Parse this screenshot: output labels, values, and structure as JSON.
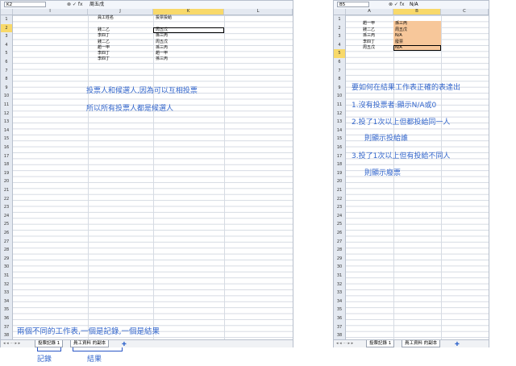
{
  "left": {
    "name_box": "K2",
    "fx_symbols": "⊗ ✓ fx",
    "formula_value": "周五戊",
    "columns": [
      "I",
      "J",
      "K",
      "L"
    ],
    "rows": [
      "1",
      "2",
      "3",
      "4",
      "5",
      "6",
      "7",
      "8",
      "9",
      "10",
      "11",
      "12",
      "13",
      "14",
      "15",
      "16",
      "17",
      "18",
      "19",
      "20",
      "21",
      "22",
      "23",
      "24",
      "25",
      "26",
      "27",
      "28",
      "29",
      "30",
      "31",
      "32",
      "33",
      "34",
      "35",
      "36",
      "37",
      "38"
    ],
    "header_voter": "員工姓名",
    "header_vote": "投票投給",
    "voters": [
      "錢二乙",
      "李四丁",
      "錢二乙",
      "趙一甲",
      "李四丁",
      "李四丁"
    ],
    "votes": [
      "周五戊",
      "孫三丙",
      "周五戊",
      "孫三丙",
      "趙一甲",
      "孫三丙"
    ],
    "note_line1": "投票人和候選人,因為可以互相投票",
    "note_line2": "所以所有投票人都是候選人",
    "bottom_note": "兩個不同的工作表,一個是記錄,一個是結果",
    "tab1": "投票記錄 1",
    "tab2": "員工資料 的副本",
    "caption_record": "記錄",
    "caption_result": "結果"
  },
  "right": {
    "name_box": "B5",
    "fx_symbols": "⊗ ✓ fx",
    "formula_value": "N/A",
    "columns": [
      "A",
      "B",
      "C"
    ],
    "rows": [
      "1",
      "2",
      "3",
      "4",
      "5",
      "6",
      "7",
      "8",
      "9",
      "10",
      "11",
      "12",
      "13",
      "14",
      "15",
      "16",
      "17",
      "18",
      "19",
      "20",
      "21",
      "22",
      "23",
      "24",
      "25",
      "26",
      "27",
      "28",
      "29",
      "30",
      "31",
      "32",
      "33",
      "34",
      "35",
      "36",
      "37",
      "38"
    ],
    "names": [
      "趙一甲",
      "錢二乙",
      "孫三丙",
      "李四丁",
      "周五戊"
    ],
    "results": [
      "孫三丙",
      "周五戊",
      "N/A",
      "廢票",
      "N/A"
    ],
    "note_title": "要如何在結果工作表正確的表達出",
    "note_1": "1.沒有投票者:顯示N/A或0",
    "note_2": "2.投了1次以上但都投給同一人",
    "note_2b": "則顯示投給誰",
    "note_3": "3.投了1次以上但有投給不同人",
    "note_3b": "則顯示廢票",
    "tab1": "投票記錄 1",
    "tab2": "員工資料 的副本"
  }
}
